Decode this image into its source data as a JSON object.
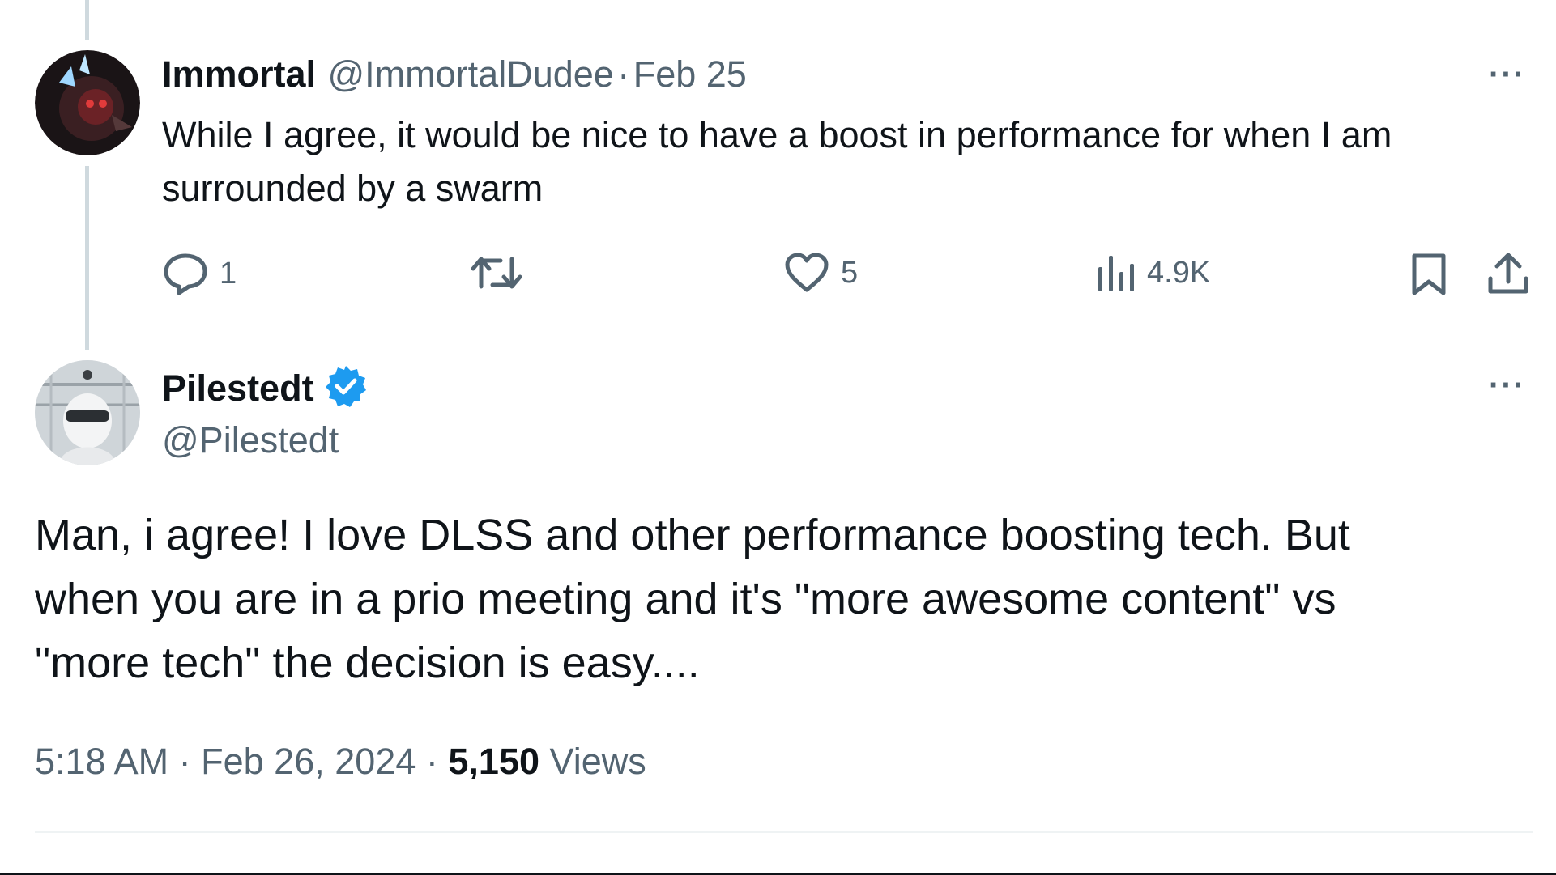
{
  "reply": {
    "author_name": "Immortal",
    "author_handle": "@ImmortalDudee",
    "separator": "·",
    "date": "Feb 25",
    "text_line1": "While I agree, it would be nice to have a boost in performance for when I am",
    "text_line2": "surrounded by a swarm",
    "more_label": "···",
    "actions": {
      "reply_count": "1",
      "like_count": "5",
      "views_count": "4.9K"
    }
  },
  "main_tweet": {
    "author_name": "Pilestedt",
    "author_handle": "@Pilestedt",
    "more_label": "···",
    "text_line1": "Man, i agree! I love DLSS and other performance boosting tech. But",
    "text_line2": "when you are in a prio meeting and it's \"more awesome content\" vs",
    "text_line3": "\"more tech\" the decision is easy....",
    "time": "5:18 AM",
    "date": "Feb 26, 2024",
    "views_count": "5,150",
    "views_label": "Views",
    "sep": "·"
  },
  "icons": {
    "reply": "reply-icon",
    "retweet": "retweet-icon",
    "like": "heart-icon",
    "views": "views-icon",
    "bookmark": "bookmark-icon",
    "share": "share-icon",
    "verified": "verified-badge-icon"
  },
  "colors": {
    "text": "#0f1419",
    "secondary": "#536471",
    "verified": "#1d9bf0",
    "thread_line": "#cfd9de"
  }
}
